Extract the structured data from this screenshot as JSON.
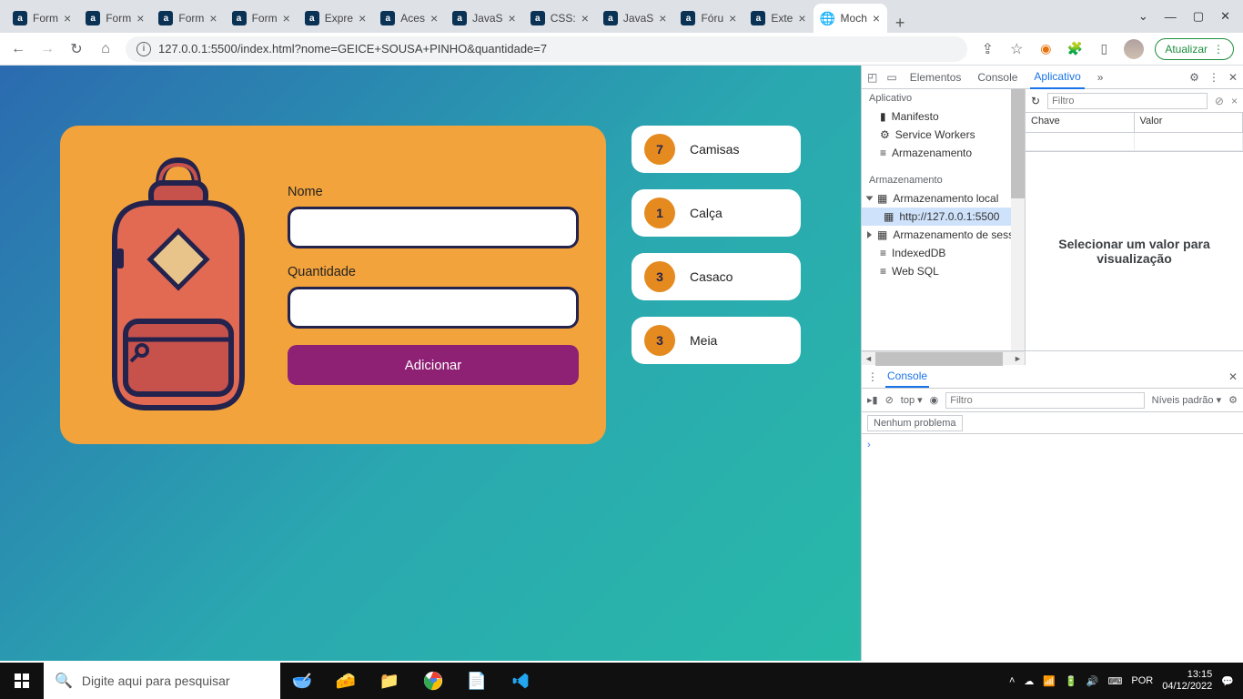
{
  "browser": {
    "tabs": [
      {
        "label": "Form",
        "favicon": "a"
      },
      {
        "label": "Form",
        "favicon": "a"
      },
      {
        "label": "Form",
        "favicon": "a"
      },
      {
        "label": "Form",
        "favicon": "a"
      },
      {
        "label": "Expre",
        "favicon": "a"
      },
      {
        "label": "Aces",
        "favicon": "a"
      },
      {
        "label": "JavaS",
        "favicon": "a"
      },
      {
        "label": "CSS:",
        "favicon": "a"
      },
      {
        "label": "JavaS",
        "favicon": "a"
      },
      {
        "label": "Fóru",
        "favicon": "a"
      },
      {
        "label": "Exte",
        "favicon": "a"
      },
      {
        "label": "Moch",
        "favicon": "globe",
        "active": true
      }
    ],
    "url": "127.0.0.1:5500/index.html?nome=GEICE+SOUSA+PINHO&quantidade=7",
    "update_label": "Atualizar"
  },
  "app": {
    "form": {
      "name_label": "Nome",
      "name_value": "",
      "qty_label": "Quantidade",
      "qty_value": "",
      "submit_label": "Adicionar"
    },
    "items": [
      {
        "qty": "7",
        "name": "Camisas"
      },
      {
        "qty": "1",
        "name": "Calça"
      },
      {
        "qty": "3",
        "name": "Casaco"
      },
      {
        "qty": "3",
        "name": "Meia"
      }
    ]
  },
  "devtools": {
    "tabs": {
      "elements": "Elementos",
      "console": "Console",
      "application": "Aplicativo"
    },
    "filter_placeholder": "Filtro",
    "table": {
      "key": "Chave",
      "value": "Valor"
    },
    "sidebar": {
      "application": "Aplicativo",
      "manifest": "Manifesto",
      "service_workers": "Service Workers",
      "storage_root": "Armazenamento",
      "storage": "Armazenamento",
      "local_storage": "Armazenamento local",
      "local_storage_url": "http://127.0.0.1:5500",
      "session_storage": "Armazenamento de sessão",
      "indexeddb": "IndexedDB",
      "websql": "Web SQL"
    },
    "placeholder": "Selecionar um valor para visualização",
    "console": {
      "title": "Console",
      "top": "top ▾",
      "levels": "Níveis padrão ▾",
      "filter_placeholder": "Filtro",
      "no_issues": "Nenhum problema"
    }
  },
  "taskbar": {
    "search_placeholder": "Digite aqui para pesquisar",
    "lang": "POR",
    "time": "13:15",
    "date": "04/12/2022"
  }
}
